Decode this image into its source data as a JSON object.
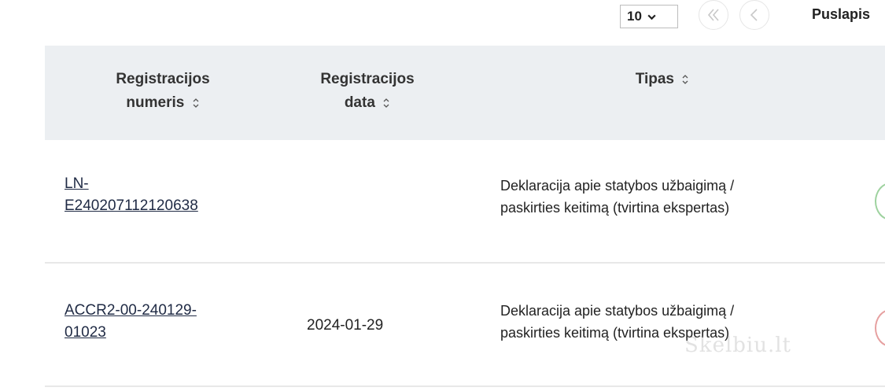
{
  "pagination": {
    "page_size": "10",
    "page_label": "Puslapis",
    "first_icon": "double-chevron-left-icon",
    "prev_icon": "chevron-left-icon"
  },
  "table": {
    "columns": [
      {
        "line1": "Registracijos",
        "line2": "numeris"
      },
      {
        "line1": "Registracijos",
        "line2": "data"
      },
      {
        "line1": "Tipas",
        "line2": ""
      }
    ],
    "rows": [
      {
        "reg_no_1": "LN-",
        "reg_no_2": "E240207112120638",
        "date": "",
        "type_1": "Deklaracija apie statybos užbaigimą /",
        "type_2": "paskirties keitimą (tvirtina ekspertas)",
        "status_color": "#9ed29f"
      },
      {
        "reg_no_1": "ACCR2-00-240129-",
        "reg_no_2": "01023",
        "date": "2024-01-29",
        "type_1": "Deklaracija apie statybos užbaigimą /",
        "type_2": "paskirties keitimą (tvirtina ekspertas)",
        "status_color": "#e6a0a0"
      }
    ]
  },
  "watermark": "Skelbiu.lt"
}
